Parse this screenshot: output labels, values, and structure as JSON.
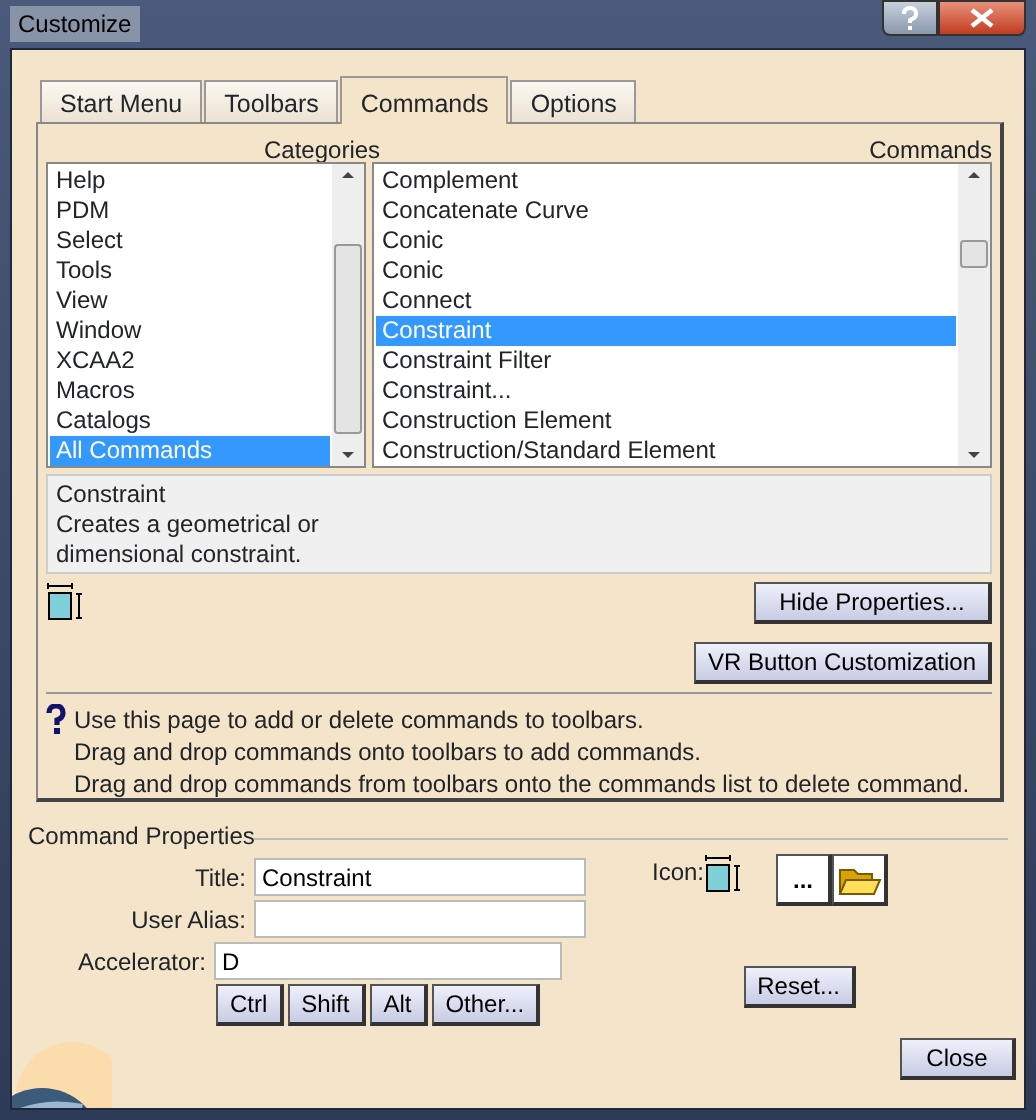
{
  "window": {
    "title": "Customize"
  },
  "tabs": [
    {
      "label": "Start Menu",
      "selected": false
    },
    {
      "label": "Toolbars",
      "selected": false
    },
    {
      "label": "Commands",
      "selected": true
    },
    {
      "label": "Options",
      "selected": false
    }
  ],
  "categories": {
    "heading": "Categories",
    "items": [
      {
        "label": "Help",
        "selected": false
      },
      {
        "label": "PDM",
        "selected": false
      },
      {
        "label": "Select",
        "selected": false
      },
      {
        "label": "Tools",
        "selected": false
      },
      {
        "label": "View",
        "selected": false
      },
      {
        "label": "Window",
        "selected": false
      },
      {
        "label": "XCAA2",
        "selected": false
      },
      {
        "label": "Macros",
        "selected": false
      },
      {
        "label": "Catalogs",
        "selected": false
      },
      {
        "label": "All Commands",
        "selected": true
      }
    ]
  },
  "commands": {
    "heading": "Commands",
    "items": [
      {
        "label": "Complement",
        "selected": false
      },
      {
        "label": "Concatenate Curve",
        "selected": false
      },
      {
        "label": "Conic",
        "selected": false
      },
      {
        "label": "Conic",
        "selected": false
      },
      {
        "label": "Connect",
        "selected": false
      },
      {
        "label": "Constraint",
        "selected": true
      },
      {
        "label": "Constraint Filter",
        "selected": false
      },
      {
        "label": "Constraint...",
        "selected": false
      },
      {
        "label": "Construction Element",
        "selected": false
      },
      {
        "label": "Construction/Standard Element",
        "selected": false
      }
    ]
  },
  "description": {
    "title": "Constraint",
    "lines": [
      "Creates a geometrical or",
      "dimensional constraint."
    ]
  },
  "hide_properties_button": "Hide Properties...",
  "vr_button": "VR Button Customization",
  "help_lines": [
    "Use this page to add or delete commands to toolbars.",
    "Drag and drop commands onto toolbars to add commands.",
    "Drag and drop commands from toolbars onto the commands list to delete command."
  ],
  "command_properties": {
    "heading": "Command Properties",
    "fields": [
      {
        "label": "Title:",
        "value": "Constraint"
      },
      {
        "label": "User Alias:"
      },
      {
        "label": "Accelerator:",
        "value": "D"
      }
    ],
    "modifier_buttons": [
      "Ctrl",
      "Shift",
      "Alt",
      "Other..."
    ],
    "icon_label": "Icon:",
    "browse_button": "...",
    "reset_button": "Reset..."
  },
  "close_button": "Close"
}
